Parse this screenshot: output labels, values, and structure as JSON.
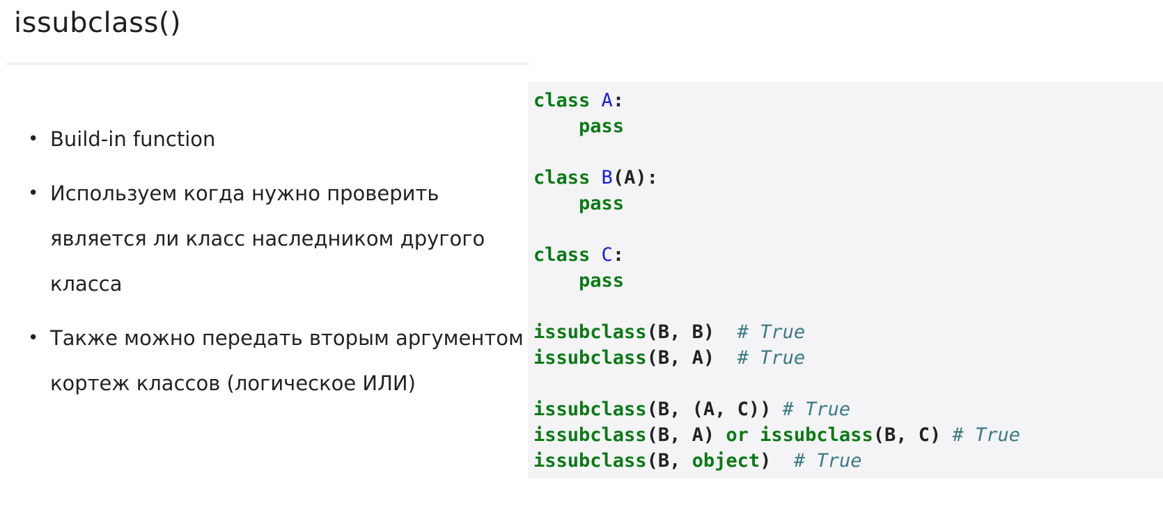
{
  "slide": {
    "title": "issubclass()"
  },
  "bullets": [
    "Build-in function",
    "Используем когда нужно проверить является ли класс наследником другого класса",
    "Также можно передать вторым аргументом кортеж классов (логическое ИЛИ)"
  ],
  "code": {
    "lines": [
      [
        {
          "t": "class",
          "c": "kw"
        },
        {
          "t": " ",
          "c": "plain"
        },
        {
          "t": "A",
          "c": "cls"
        },
        {
          "t": ":",
          "c": "plain"
        }
      ],
      [
        {
          "t": "    ",
          "c": "plain"
        },
        {
          "t": "pass",
          "c": "kw"
        }
      ],
      [],
      [
        {
          "t": "class",
          "c": "kw"
        },
        {
          "t": " ",
          "c": "plain"
        },
        {
          "t": "B",
          "c": "cls"
        },
        {
          "t": "(A):",
          "c": "plain"
        }
      ],
      [
        {
          "t": "    ",
          "c": "plain"
        },
        {
          "t": "pass",
          "c": "kw"
        }
      ],
      [],
      [
        {
          "t": "class",
          "c": "kw"
        },
        {
          "t": " ",
          "c": "plain"
        },
        {
          "t": "C",
          "c": "cls"
        },
        {
          "t": ":",
          "c": "plain"
        }
      ],
      [
        {
          "t": "    ",
          "c": "plain"
        },
        {
          "t": "pass",
          "c": "kw"
        }
      ],
      [],
      [
        {
          "t": "issubclass",
          "c": "kw"
        },
        {
          "t": "(B, B)  ",
          "c": "plain"
        },
        {
          "t": "# True",
          "c": "comment"
        }
      ],
      [
        {
          "t": "issubclass",
          "c": "kw"
        },
        {
          "t": "(B, A)  ",
          "c": "plain"
        },
        {
          "t": "# True",
          "c": "comment"
        }
      ],
      [],
      [
        {
          "t": "issubclass",
          "c": "kw"
        },
        {
          "t": "(B, (A, C)) ",
          "c": "plain"
        },
        {
          "t": "# True",
          "c": "comment"
        }
      ],
      [
        {
          "t": "issubclass",
          "c": "kw"
        },
        {
          "t": "(B, A) ",
          "c": "plain"
        },
        {
          "t": "or",
          "c": "kw"
        },
        {
          "t": " ",
          "c": "plain"
        },
        {
          "t": "issubclass",
          "c": "kw"
        },
        {
          "t": "(B, C) ",
          "c": "plain"
        },
        {
          "t": "# True",
          "c": "comment"
        }
      ],
      [
        {
          "t": "issubclass",
          "c": "kw"
        },
        {
          "t": "(B, ",
          "c": "plain"
        },
        {
          "t": "object",
          "c": "kw"
        },
        {
          "t": ")  ",
          "c": "plain"
        },
        {
          "t": "# True",
          "c": "comment"
        }
      ]
    ]
  },
  "colors": {
    "keyword": "#0a7a14",
    "class_name": "#1a1adf",
    "comment": "#3b7b82",
    "code_background": "#f4f3f6"
  }
}
